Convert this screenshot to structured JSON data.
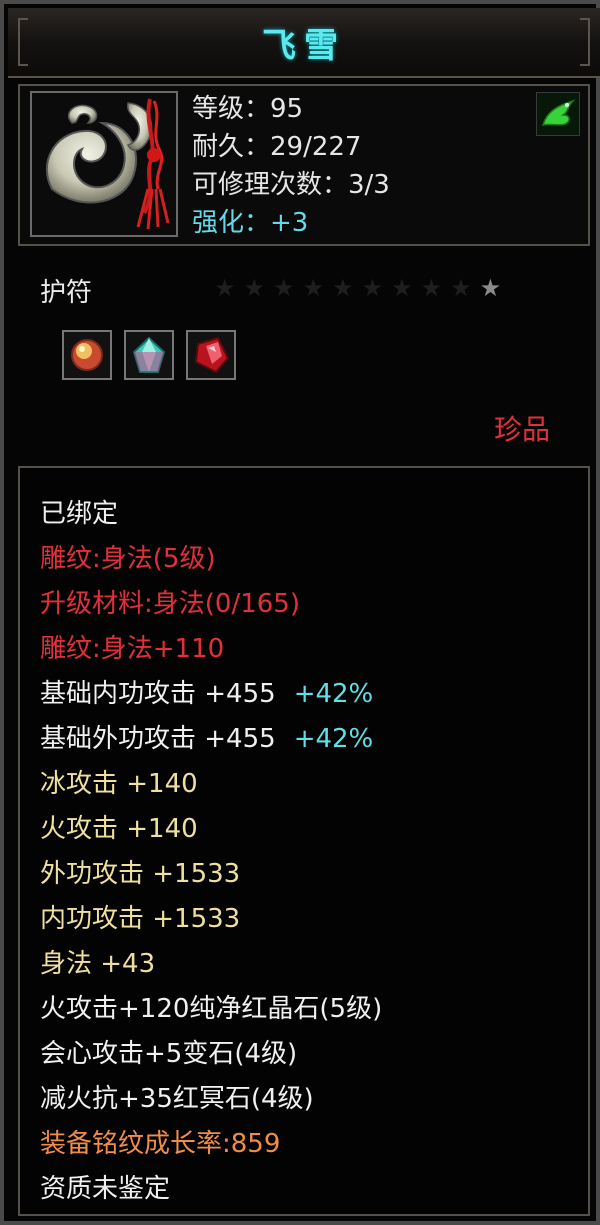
{
  "item": {
    "name": "飞雪",
    "level": "等级：95",
    "durability": "耐久：29/227",
    "repair_count": "可修理次数：3/3",
    "enhance": "强化：+3",
    "type": "护符",
    "rarity": "珍品",
    "stars": "★★★★★★★★★",
    "star_lit": "★",
    "gems": [
      "red-orange-gem-icon",
      "teal-crystal-gem-icon",
      "red-crystal-gem-icon"
    ],
    "badge_icon": "green-dragon-icon"
  },
  "attributes": [
    {
      "text": "已绑定",
      "color": "white"
    },
    {
      "text": "雕纹:身法(5级)",
      "color": "red"
    },
    {
      "text": "升级材料:身法(0/165)",
      "color": "red"
    },
    {
      "text": "雕纹:身法+110",
      "color": "red"
    },
    {
      "text": "基础内功攻击  +455",
      "extra": "+42%",
      "color": "white"
    },
    {
      "text": "基础外功攻击  +455",
      "extra": "+42%",
      "color": "white"
    },
    {
      "text": "冰攻击  +140",
      "color": "yellow"
    },
    {
      "text": "火攻击  +140",
      "color": "yellow"
    },
    {
      "text": "外功攻击  +1533",
      "color": "yellow"
    },
    {
      "text": "内功攻击  +1533",
      "color": "yellow"
    },
    {
      "text": "身法  +43",
      "color": "yellow"
    },
    {
      "text": "火攻击+120纯净红晶石(5级)",
      "color": "white"
    },
    {
      "text": "会心攻击+5变石(4级)",
      "color": "white"
    },
    {
      "text": "减火抗+35红冥石(4级)",
      "color": "white"
    },
    {
      "text": "装备铭纹成长率:859",
      "color": "orange"
    },
    {
      "text": "资质未鉴定",
      "color": "white"
    }
  ]
}
